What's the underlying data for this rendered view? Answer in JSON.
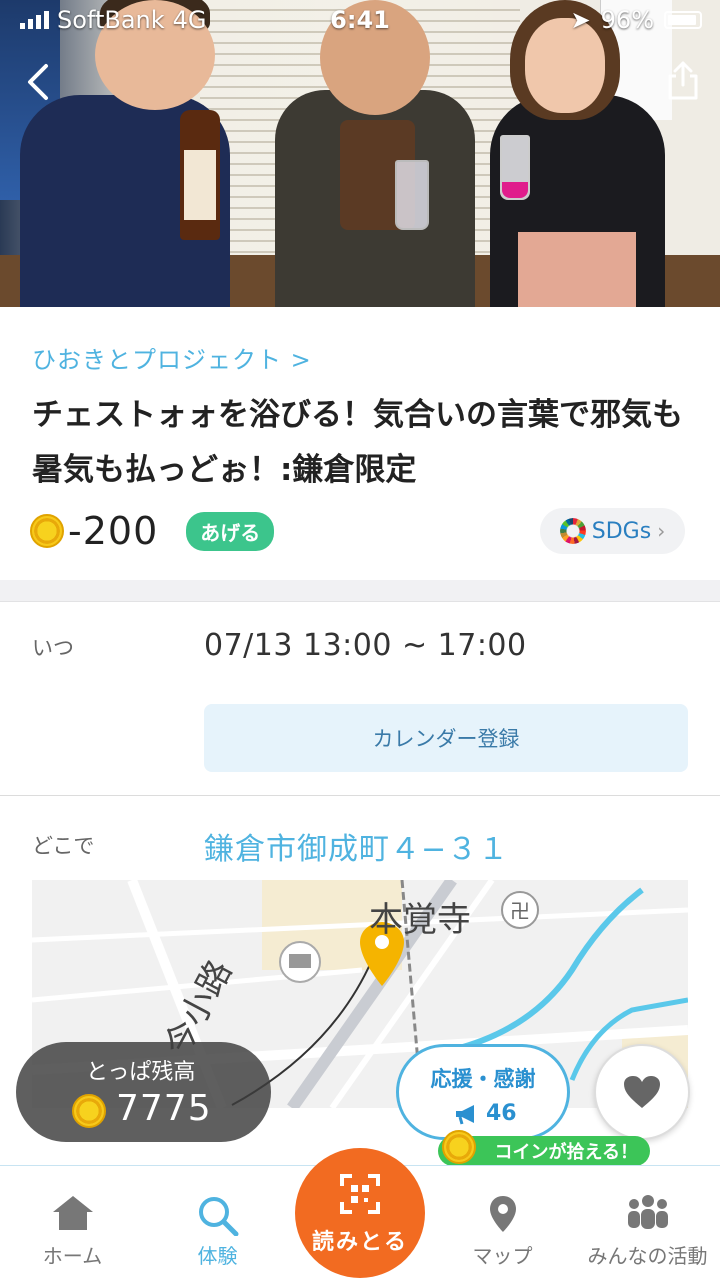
{
  "status_bar": {
    "carrier": "SoftBank",
    "network": "4G",
    "time": "6:41",
    "battery": "96%"
  },
  "header": {
    "back_icon": "chevron-left-icon",
    "share_icon": "share-icon"
  },
  "event": {
    "organizer": "ひおきとプロジェクト >",
    "title": "チェストォォを浴びる！気合いの言葉で邪気も暑気も払っどぉ！:鎌倉限定",
    "points": "-200",
    "give_label": "あげる",
    "sdgs_label": "SDGs",
    "when_label": "いつ",
    "when_value": "07/13 13:00 ~ 17:00",
    "calendar_button": "カレンダー登録",
    "where_label": "どこで",
    "where_value": "鎌倉市御成町４−３１"
  },
  "map": {
    "place_label": "本覚寺",
    "road_label": "今小路",
    "provider": "Google"
  },
  "overlays": {
    "balance_label": "とっぱ残高",
    "balance_value": "7775",
    "support_label": "応援・感謝",
    "support_count": "46",
    "coin_banner": "コインが拾える！"
  },
  "tabs": [
    {
      "label": "ホーム",
      "icon": "home-icon"
    },
    {
      "label": "体験",
      "icon": "search-icon"
    },
    {
      "label": "読みとる",
      "icon": "qr-scan-icon"
    },
    {
      "label": "マップ",
      "icon": "map-pin-icon"
    },
    {
      "label": "みんなの活動",
      "icon": "people-icon"
    }
  ],
  "colors": {
    "accent_blue": "#4fb3e0",
    "green": "#3cc58c",
    "orange": "#f26b21",
    "coin_yellow": "#f7d21e"
  }
}
